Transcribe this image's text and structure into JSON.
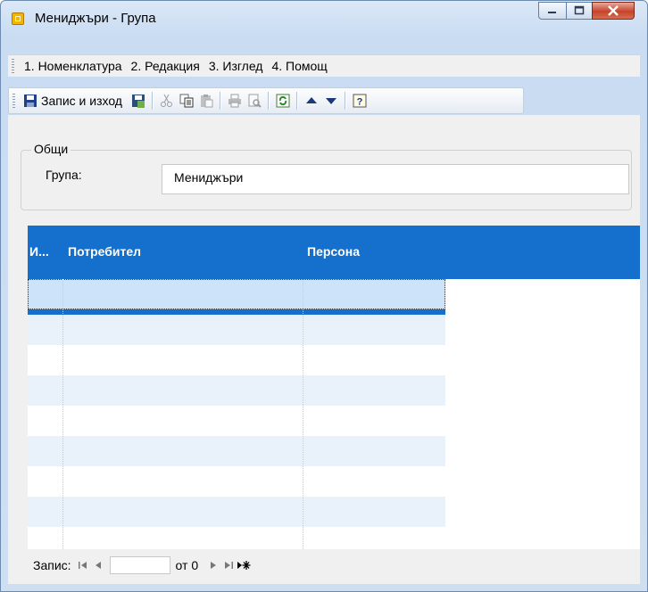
{
  "window": {
    "title": "Мениджъри - Група",
    "controls": {
      "minimize": "—",
      "maximize": "☐",
      "close": "✕"
    }
  },
  "menu": [
    {
      "label": "1. Номенклатура"
    },
    {
      "label": "2. Редакция"
    },
    {
      "label": "3. Изглед"
    },
    {
      "label": "4. Помощ"
    }
  ],
  "toolbar": {
    "save_exit_label": "Запис и изход",
    "icons": [
      "save-icon",
      "save-new-icon",
      "cut-icon",
      "copy-icon",
      "paste-icon",
      "print-icon",
      "print-preview-icon",
      "refresh-icon",
      "arrow-up-icon",
      "arrow-down-icon",
      "help-icon"
    ]
  },
  "group": {
    "legend": "Общи",
    "field_label": "Група:",
    "field_value": "Мениджъри"
  },
  "grid": {
    "columns": [
      {
        "label": "И..."
      },
      {
        "label": "Потребител"
      },
      {
        "label": "Персона"
      }
    ],
    "rows": []
  },
  "navigator": {
    "label": "Запис:",
    "current": "",
    "of_label": "от 0"
  }
}
